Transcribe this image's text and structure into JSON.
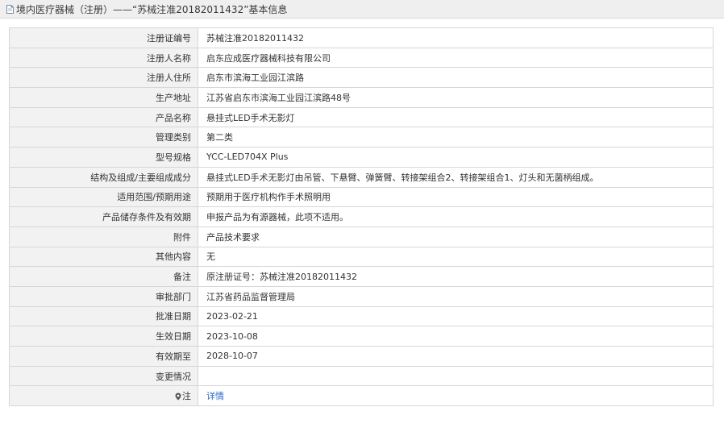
{
  "header": {
    "icon": "document-icon",
    "title": "境内医疗器械（注册）——“苏械注准20182011432”基本信息"
  },
  "rows": [
    {
      "label": "注册证编号",
      "value": "苏械注准20182011432"
    },
    {
      "label": "注册人名称",
      "value": "启东应成医疗器械科技有限公司"
    },
    {
      "label": "注册人住所",
      "value": "启东市滨海工业园江滨路"
    },
    {
      "label": "生产地址",
      "value": "江苏省启东市滨海工业园江滨路48号"
    },
    {
      "label": "产品名称",
      "value": "悬挂式LED手术无影灯"
    },
    {
      "label": "管理类别",
      "value": "第二类"
    },
    {
      "label": "型号规格",
      "value": "YCC-LED704X Plus"
    },
    {
      "label": "结构及组成/主要组成成分",
      "value": "悬挂式LED手术无影灯由吊管、下悬臂、弹簧臂、转接架组合2、转接架组合1、灯头和无菌柄组成。"
    },
    {
      "label": "适用范围/预期用途",
      "value": "预期用于医疗机构作手术照明用"
    },
    {
      "label": "产品储存条件及有效期",
      "value": "申报产品为有源器械，此项不适用。"
    },
    {
      "label": "附件",
      "value": "产品技术要求"
    },
    {
      "label": "其他内容",
      "value": "无"
    },
    {
      "label": "备注",
      "value": "原注册证号：苏械注准20182011432"
    },
    {
      "label": "审批部门",
      "value": "江苏省药品监督管理局"
    },
    {
      "label": "批准日期",
      "value": "2023-02-21"
    },
    {
      "label": "生效日期",
      "value": "2023-10-08"
    },
    {
      "label": "有效期至",
      "value": "2028-10-07"
    },
    {
      "label": "变更情况",
      "value": ""
    }
  ],
  "note_row": {
    "icon": "info-pin-icon",
    "label": "注",
    "link_text": "详情"
  },
  "colors": {
    "header_bg": "#efefef",
    "label_bg": "#f2f2f2",
    "border": "#d6d6d6",
    "link": "#2b6cc4"
  }
}
